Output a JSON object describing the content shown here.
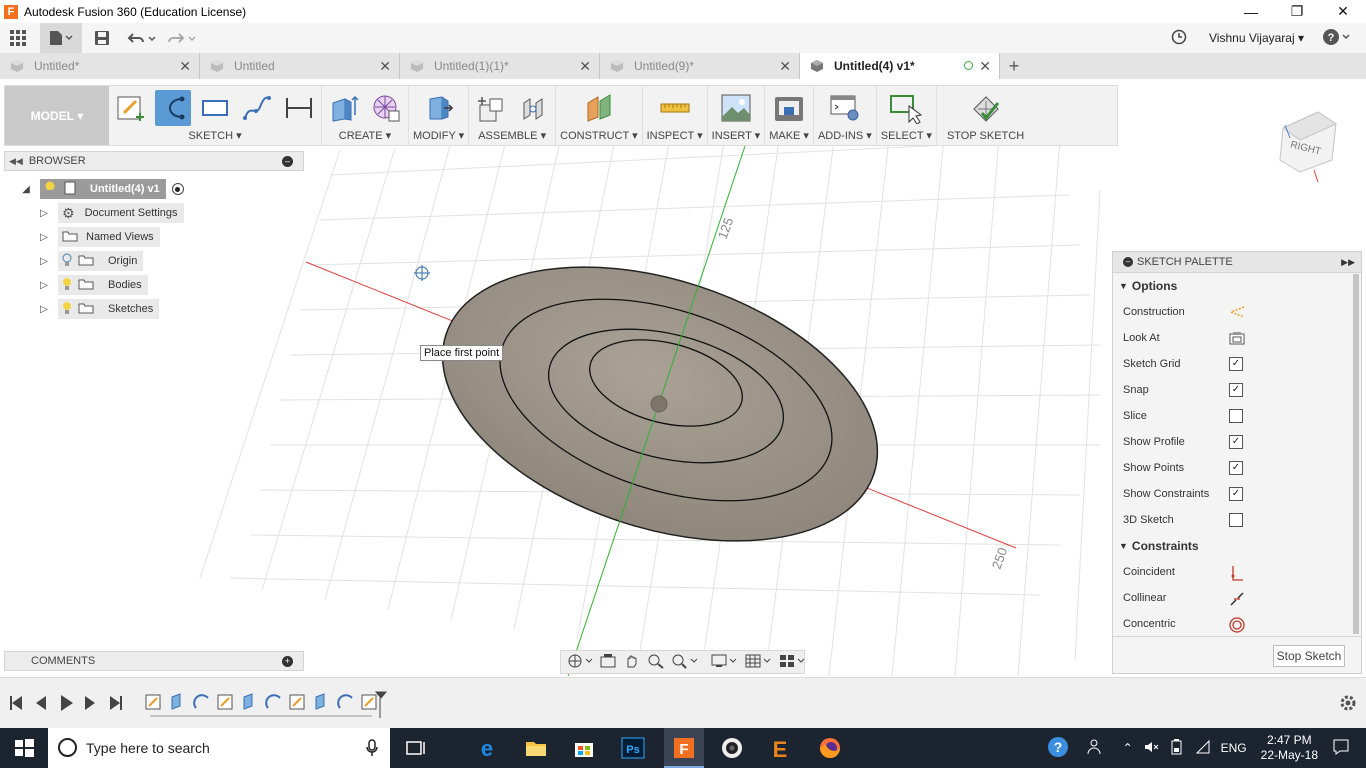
{
  "window": {
    "title": "Autodesk Fusion 360 (Education License)"
  },
  "appbar": {
    "user": "Vishnu Vijayaraj",
    "help": "?"
  },
  "tabs": [
    {
      "label": "Untitled*"
    },
    {
      "label": "Untitled"
    },
    {
      "label": "Untitled(1)(1)*"
    },
    {
      "label": "Untitled(9)*"
    },
    {
      "label": "Untitled(4) v1*"
    }
  ],
  "toolbar": {
    "mode": "MODEL",
    "groups": [
      "SKETCH",
      "CREATE",
      "MODIFY",
      "ASSEMBLE",
      "CONSTRUCT",
      "INSPECT",
      "INSERT",
      "MAKE",
      "ADD-INS",
      "SELECT",
      "STOP SKETCH"
    ]
  },
  "browser": {
    "title": "BROWSER",
    "root": "Untitled(4) v1",
    "items": [
      "Document Settings",
      "Named Views",
      "Origin",
      "Bodies",
      "Sketches"
    ]
  },
  "viewcube": {
    "face": "RIGHT"
  },
  "canvas": {
    "tooltip": "Place first point",
    "axis_label_top": "125",
    "axis_label_right": "250"
  },
  "palette": {
    "title": "SKETCH PALETTE",
    "options_title": "Options",
    "options": [
      {
        "label": "Construction",
        "control": "icon"
      },
      {
        "label": "Look At",
        "control": "icon"
      },
      {
        "label": "Sketch Grid",
        "control": "checkbox",
        "checked": true
      },
      {
        "label": "Snap",
        "control": "checkbox",
        "checked": true
      },
      {
        "label": "Slice",
        "control": "checkbox",
        "checked": false
      },
      {
        "label": "Show Profile",
        "control": "checkbox",
        "checked": true
      },
      {
        "label": "Show Points",
        "control": "checkbox",
        "checked": true
      },
      {
        "label": "Show Constraints",
        "control": "checkbox",
        "checked": true
      },
      {
        "label": "3D Sketch",
        "control": "checkbox",
        "checked": false
      }
    ],
    "constraints_title": "Constraints",
    "constraints": [
      "Coincident",
      "Collinear",
      "Concentric"
    ],
    "stop_button": "Stop Sketch"
  },
  "comments": {
    "title": "COMMENTS"
  },
  "taskbar": {
    "search_placeholder": "Type here to search",
    "language": "ENG",
    "time": "2:47 PM",
    "date": "22-May-18"
  },
  "colors": {
    "accent": "#5b9bd5",
    "body": "#8a8378",
    "x_axis": "#e04040",
    "y_axis": "#30b030"
  }
}
